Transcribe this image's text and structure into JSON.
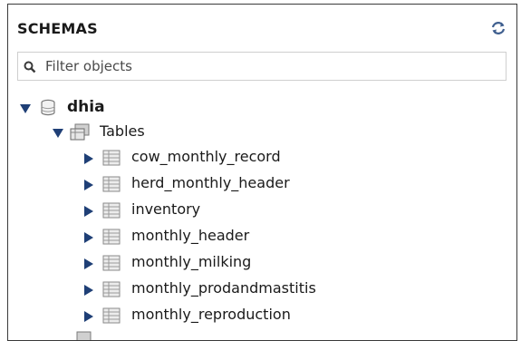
{
  "panel": {
    "title": "SCHEMAS",
    "refresh_icon": "refresh-icon"
  },
  "filter": {
    "placeholder": "Filter objects",
    "value": ""
  },
  "tree": {
    "schema": {
      "name": "dhia",
      "expanded": true,
      "icon": "database-icon"
    },
    "tables_group": {
      "label": "Tables",
      "expanded": true,
      "icon": "tables-folder-icon"
    },
    "tables": [
      {
        "name": "cow_monthly_record"
      },
      {
        "name": "herd_monthly_header"
      },
      {
        "name": "inventory"
      },
      {
        "name": "monthly_header"
      },
      {
        "name": "monthly_milking"
      },
      {
        "name": "monthly_prodandmastitis"
      },
      {
        "name": "monthly_reproduction"
      }
    ]
  },
  "colors": {
    "arrow": "#1f3f76",
    "icon_gray": "#8a8a8a",
    "border": "#3a3a3a"
  }
}
